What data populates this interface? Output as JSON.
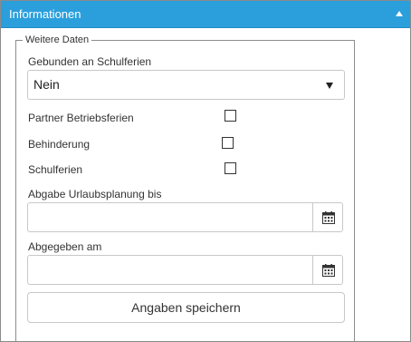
{
  "panel": {
    "title": "Informationen",
    "collapse_icon": "chevron-up-icon",
    "header_color": "#2a9fdc"
  },
  "section": {
    "legend": "Weitere Daten"
  },
  "fields": {
    "school_holidays_bound": {
      "label": "Gebunden an Schulferien",
      "selected": "Nein",
      "arrow_icon": "caret-down-icon"
    },
    "partner_company_holidays": {
      "label": "Partner Betriebsferien",
      "checked": false
    },
    "disability": {
      "label": "Behinderung",
      "checked": false
    },
    "school_holidays": {
      "label": "Schulferien",
      "checked": false
    },
    "vacation_planning_due": {
      "label": "Abgabe Urlaubsplanung bis",
      "value": "",
      "icon": "calendar-icon"
    },
    "submitted_on": {
      "label": "Abgegeben am",
      "value": "",
      "icon": "calendar-icon"
    }
  },
  "actions": {
    "save_label": "Angaben speichern"
  }
}
